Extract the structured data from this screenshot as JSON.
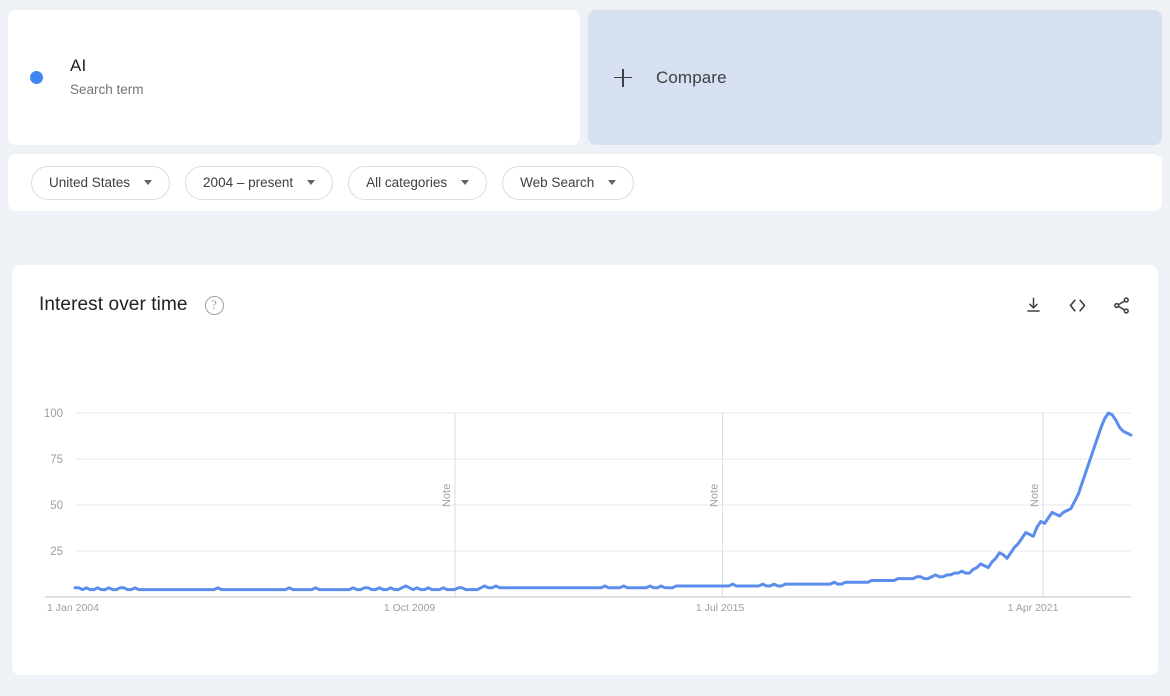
{
  "term_card": {
    "title": "AI",
    "subtitle": "Search term",
    "dot_color": "#4285f4"
  },
  "compare": {
    "label": "Compare",
    "icon": "plus-icon",
    "background": "#d7e0f1"
  },
  "filters": [
    {
      "label": "United States",
      "name": "region-filter"
    },
    {
      "label": "2004 – present",
      "name": "time-range-filter"
    },
    {
      "label": "All categories",
      "name": "category-filter"
    },
    {
      "label": "Web Search",
      "name": "search-type-filter"
    }
  ],
  "chart_panel": {
    "title": "Interest over time",
    "help_icon": "help-circle-icon",
    "actions": [
      {
        "name": "download-csv-button",
        "icon": "download-icon"
      },
      {
        "name": "embed-button",
        "icon": "code-brackets-icon"
      },
      {
        "name": "share-button",
        "icon": "share-icon"
      }
    ]
  },
  "chart_data": {
    "type": "line",
    "title": "Interest over time",
    "xlabel": "",
    "ylabel": "",
    "ylim": [
      0,
      100
    ],
    "yticks": [
      25,
      50,
      75,
      100
    ],
    "grid": true,
    "legend_position": "none",
    "line_color": "#5b8ded",
    "xticks": [
      {
        "label": "1 Jan 2004",
        "x": 0.0
      },
      {
        "label": "1 Oct 2009",
        "x": 0.2925
      },
      {
        "label": "1 Jul 2015",
        "x": 0.5879
      },
      {
        "label": "1 Apr 2021",
        "x": 0.8832
      }
    ],
    "annotations": [
      {
        "label": "Note",
        "x": 0.3599
      },
      {
        "label": "Note",
        "x": 0.6131
      },
      {
        "label": "Note",
        "x": 0.9167
      }
    ],
    "series": [
      {
        "name": "AI",
        "color": "#5b8ded",
        "values": [
          5,
          5,
          4,
          5,
          4,
          4,
          5,
          4,
          4,
          5,
          4,
          4,
          5,
          5,
          4,
          4,
          5,
          4,
          4,
          4,
          4,
          4,
          4,
          4,
          4,
          4,
          4,
          4,
          4,
          4,
          4,
          4,
          4,
          4,
          4,
          4,
          4,
          4,
          5,
          4,
          4,
          4,
          4,
          4,
          4,
          4,
          4,
          4,
          4,
          4,
          4,
          4,
          4,
          4,
          4,
          4,
          4,
          5,
          4,
          4,
          4,
          4,
          4,
          4,
          5,
          4,
          4,
          4,
          4,
          4,
          4,
          4,
          4,
          4,
          5,
          4,
          4,
          5,
          5,
          4,
          4,
          5,
          4,
          4,
          5,
          4,
          4,
          5,
          6,
          5,
          4,
          5,
          4,
          4,
          5,
          4,
          4,
          4,
          5,
          4,
          4,
          4,
          5,
          5,
          4,
          4,
          4,
          4,
          5,
          6,
          5,
          5,
          6,
          5,
          5,
          5,
          5,
          5,
          5,
          5,
          5,
          5,
          5,
          5,
          5,
          5,
          5,
          5,
          5,
          5,
          5,
          5,
          5,
          5,
          5,
          5,
          5,
          5,
          5,
          5,
          5,
          6,
          5,
          5,
          5,
          5,
          6,
          5,
          5,
          5,
          5,
          5,
          5,
          6,
          5,
          5,
          6,
          5,
          5,
          5,
          6,
          6,
          6,
          6,
          6,
          6,
          6,
          6,
          6,
          6,
          6,
          6,
          6,
          6,
          6,
          7,
          6,
          6,
          6,
          6,
          6,
          6,
          6,
          7,
          6,
          6,
          7,
          6,
          6,
          7,
          7,
          7,
          7,
          7,
          7,
          7,
          7,
          7,
          7,
          7,
          7,
          7,
          8,
          7,
          7,
          8,
          8,
          8,
          8,
          8,
          8,
          8,
          9,
          9,
          9,
          9,
          9,
          9,
          9,
          10,
          10,
          10,
          10,
          10,
          11,
          11,
          10,
          10,
          11,
          12,
          11,
          11,
          12,
          12,
          13,
          13,
          14,
          13,
          13,
          15,
          16,
          18,
          17,
          16,
          19,
          21,
          24,
          23,
          21,
          24,
          27,
          29,
          32,
          35,
          34,
          33,
          38,
          41,
          40,
          43,
          46,
          45,
          44,
          46,
          47,
          48,
          52,
          56,
          62,
          68,
          74,
          80,
          86,
          92,
          97,
          100,
          99,
          96,
          92,
          90,
          89,
          88
        ]
      }
    ]
  }
}
